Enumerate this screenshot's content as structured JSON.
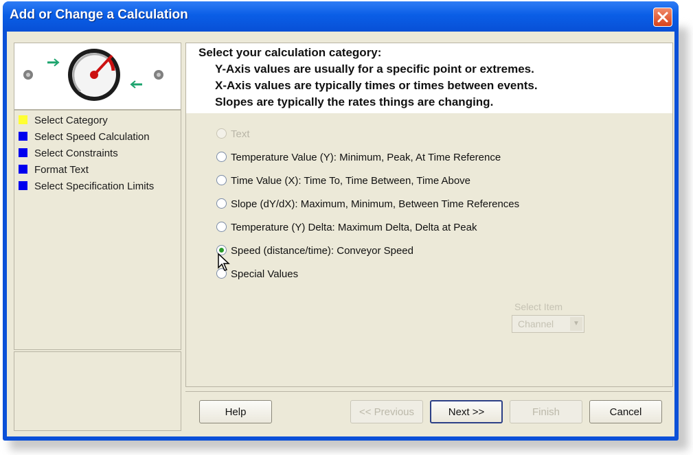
{
  "window": {
    "title": "Add or Change a Calculation"
  },
  "sidebar": {
    "steps": [
      {
        "label": "Select Category",
        "color": "#ffff33"
      },
      {
        "label": "Select Speed Calculation",
        "color": "#0000ee"
      },
      {
        "label": "Select Constraints",
        "color": "#0000ee"
      },
      {
        "label": "Format Text",
        "color": "#0000ee"
      },
      {
        "label": "Select Specification Limits",
        "color": "#0000ee"
      }
    ]
  },
  "main": {
    "heading": "Select your calculation category:",
    "lines": [
      "Y-Axis values are usually for a specific point or extremes.",
      "X-Axis values are typically times or times between events.",
      "Slopes are typically the rates things are changing."
    ],
    "options": [
      {
        "label": "Text",
        "selected": false,
        "enabled": false
      },
      {
        "label": "Temperature Value (Y):  Minimum, Peak, At Time Reference",
        "selected": false,
        "enabled": true
      },
      {
        "label": "Time Value (X):  Time To, Time Between, Time Above",
        "selected": false,
        "enabled": true
      },
      {
        "label": "Slope (dY/dX):  Maximum, Minimum, Between Time References",
        "selected": false,
        "enabled": true
      },
      {
        "label": "Temperature (Y) Delta:  Maximum Delta, Delta at Peak",
        "selected": false,
        "enabled": true
      },
      {
        "label": "Speed (distance/time):  Conveyor Speed",
        "selected": true,
        "enabled": true
      },
      {
        "label": "Special  Values",
        "selected": false,
        "enabled": true
      }
    ],
    "disabled_field": {
      "label": "Select Item",
      "value": "Channel"
    }
  },
  "buttons": {
    "help": "Help",
    "back": "<< Previous",
    "next": "Next >>",
    "finish": "Finish",
    "cancel": "Cancel"
  },
  "colors": {
    "titlebar": "#0a5ee6",
    "dialog_bg": "#ece9d8",
    "close_button": "#d8421a"
  }
}
